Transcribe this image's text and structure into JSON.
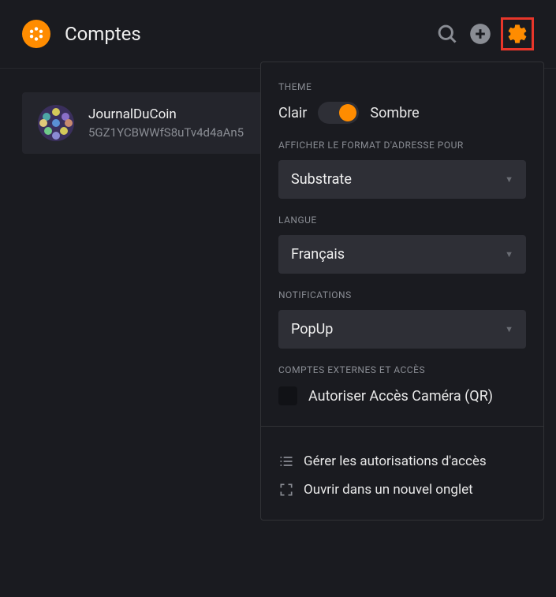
{
  "header": {
    "title": "Comptes"
  },
  "account": {
    "name": "JournalDuCoin",
    "address": "5GZ1YCBWWfS8uTv4d4aAn5"
  },
  "settings": {
    "theme": {
      "label": "THEME",
      "light": "Clair",
      "dark": "Sombre",
      "current": "dark"
    },
    "addressFormat": {
      "label": "AFFICHER LE FORMAT D'ADRESSE POUR",
      "value": "Substrate"
    },
    "language": {
      "label": "LANGUE",
      "value": "Français"
    },
    "notifications": {
      "label": "NOTIFICATIONS",
      "value": "PopUp"
    },
    "externalAccess": {
      "label": "COMPTES EXTERNES ET ACCÈS",
      "cameraLabel": "Autoriser Accès Caméra (QR)"
    },
    "actions": {
      "manageAccess": "Gérer les autorisations d'accès",
      "openNewTab": "Ouvrir dans un nouvel onglet"
    }
  }
}
